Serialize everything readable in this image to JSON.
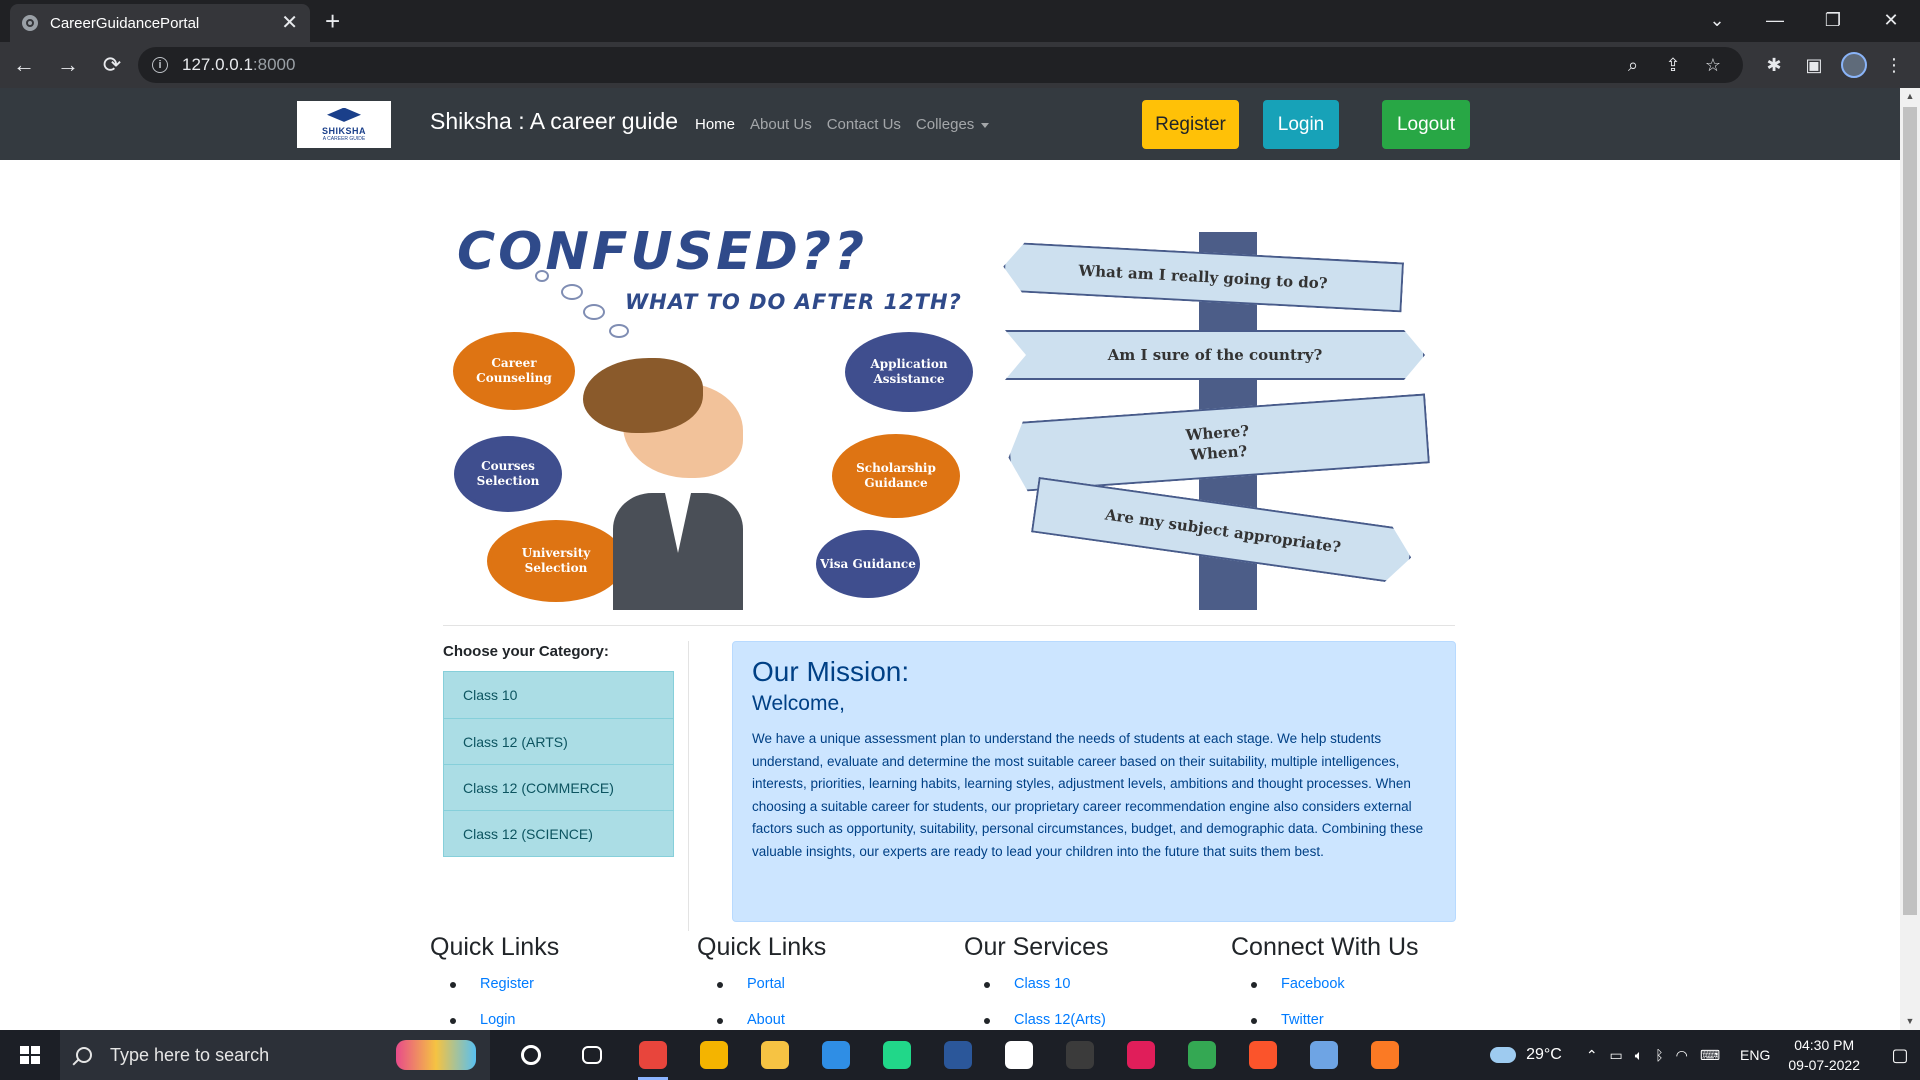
{
  "browser": {
    "tab_title": "CareerGuidancePortal",
    "tab_close": "✕",
    "new_tab": "+",
    "url_host": "127.0.0.1",
    "url_port": ":8000",
    "controls": {
      "list": "⌄",
      "minimize": "—",
      "restore": "❐",
      "close": "✕"
    },
    "nav": {
      "back": "←",
      "forward": "→",
      "reload": "⟳"
    }
  },
  "site": {
    "brand": "Shiksha : A career guide",
    "logo": {
      "name": "SHIKSHA",
      "sub": "A CAREER GUIDE"
    },
    "nav": {
      "home": "Home",
      "about": "About Us",
      "contact": "Contact Us",
      "colleges": "Colleges"
    },
    "buttons": {
      "register": "Register",
      "login": "Login",
      "logout": "Logout"
    },
    "colors": {
      "navbar": "#343a40",
      "register": "#ffc107",
      "login": "#17a2b8",
      "logout": "#28a745"
    }
  },
  "hero": {
    "title": "CONFUSED??",
    "subtitle": "WHAT TO DO AFTER 12TH?",
    "bubbles": [
      "Career Counseling",
      "Application Assistance",
      "Courses Selection",
      "Scholarship Guidance",
      "University Selection",
      "Visa Guidance"
    ],
    "signs": [
      "What am I really going to do?",
      "Am I sure of the country?",
      "Where? When?",
      "Are my subject appropriate?"
    ]
  },
  "categories": {
    "heading": "Choose your Category:",
    "items": [
      "Class 10",
      "Class 12 (ARTS)",
      "Class 12 (COMMERCE)",
      "Class 12 (SCIENCE)"
    ]
  },
  "mission": {
    "title": "Our Mission:",
    "subtitle": "Welcome,",
    "body": "We have a unique assessment plan to understand the needs of students at each stage. We help students understand, evaluate and determine the most suitable career based on their suitability, multiple intelligences, interests, priorities, learning habits, learning styles, adjustment levels, ambitions and thought processes. When choosing a suitable career for students, our proprietary career recommendation engine also considers external factors such as opportunity, suitability, personal circumstances, budget, and demographic data. Combining these valuable insights, our experts are ready to lead your children into the future that suits them best."
  },
  "footer": {
    "columns": [
      {
        "heading": "Quick Links",
        "links": [
          "Register",
          "Login"
        ]
      },
      {
        "heading": "Quick Links",
        "links": [
          "Portal",
          "About"
        ]
      },
      {
        "heading": "Our Services",
        "links": [
          "Class 10",
          "Class 12(Arts)"
        ]
      },
      {
        "heading": "Connect With Us",
        "links": [
          "Facebook",
          "Twitter"
        ]
      }
    ]
  },
  "taskbar": {
    "search_placeholder": "Type here to search",
    "weather": "29°C",
    "language": "ENG",
    "time": "04:30 PM",
    "date": "09-07-2022",
    "apps": [
      {
        "name": "cortana-icon",
        "color": "#1c1f26"
      },
      {
        "name": "task-view-icon",
        "color": "#1c1f26"
      },
      {
        "name": "chrome-icon",
        "color": "#e8453c"
      },
      {
        "name": "chrome-profile-icon",
        "color": "#f4b400"
      },
      {
        "name": "file-explorer-icon",
        "color": "#f6c343"
      },
      {
        "name": "vscode-icon",
        "color": "#2f8ee5"
      },
      {
        "name": "pycharm-icon",
        "color": "#21d789"
      },
      {
        "name": "word-icon",
        "color": "#2b579a"
      },
      {
        "name": "wordpad-icon",
        "color": "#ffffff"
      },
      {
        "name": "terminal-icon",
        "color": "#3b3b3b"
      },
      {
        "name": "slack-icon",
        "color": "#e01e5a"
      },
      {
        "name": "chrome-alt-icon",
        "color": "#34a853"
      },
      {
        "name": "brave-icon",
        "color": "#fb542b"
      },
      {
        "name": "virtualbox-icon",
        "color": "#6ea4e4"
      },
      {
        "name": "xampp-icon",
        "color": "#fb7a24"
      }
    ]
  }
}
